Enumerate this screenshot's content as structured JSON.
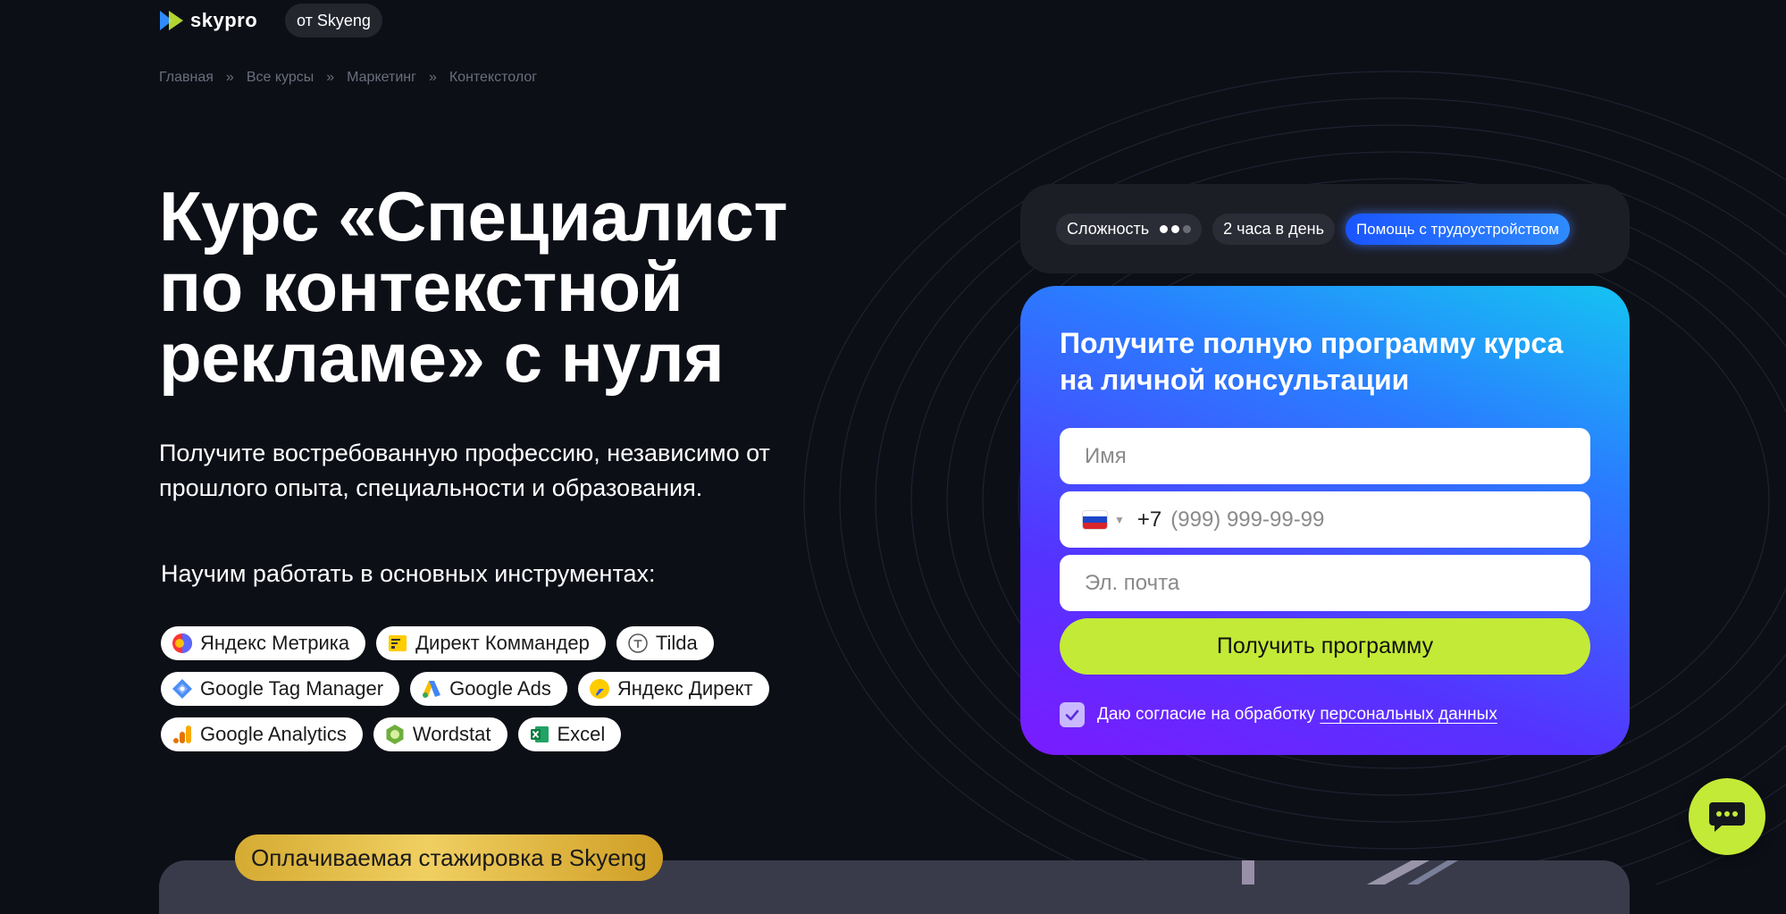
{
  "header": {
    "logo_text": "skypro",
    "from_badge": "от Skyeng"
  },
  "breadcrumb": [
    {
      "label": "Главная"
    },
    {
      "label": "Все курсы"
    },
    {
      "label": "Маркетинг"
    },
    {
      "label": "Контекстолог"
    }
  ],
  "breadcrumb_separator": "»",
  "hero": {
    "title": "Курс «Специалист по контекстной рекламе» с нуля",
    "subtitle": "Получите востребованную профессию, независимо от прошлого опыта, специальности и образования.",
    "tools_heading": "Научим работать в основных инструментах:"
  },
  "tools": [
    [
      {
        "label": "Яндекс Метрика",
        "icon": "yandex-metrika-icon"
      },
      {
        "label": "Директ Коммандер",
        "icon": "direct-commander-icon"
      },
      {
        "label": "Tilda",
        "icon": "tilda-icon"
      }
    ],
    [
      {
        "label": "Google Tag Manager",
        "icon": "google-tag-manager-icon"
      },
      {
        "label": "Google Ads",
        "icon": "google-ads-icon"
      },
      {
        "label": "Яндекс Директ",
        "icon": "yandex-direct-icon"
      }
    ],
    [
      {
        "label": "Google Analytics",
        "icon": "google-analytics-icon"
      },
      {
        "label": "Wordstat",
        "icon": "wordstat-icon"
      },
      {
        "label": "Excel",
        "icon": "excel-icon"
      }
    ]
  ],
  "info": {
    "difficulty_label": "Сложность",
    "difficulty_level": 2,
    "difficulty_max": 3,
    "hours_label": "2 часа в день",
    "job_help_label": "Помощь с трудоустройством"
  },
  "form": {
    "title": "Получите полную программу курса на личной консультации",
    "name_placeholder": "Имя",
    "phone_country": "RU",
    "phone_code": "+7",
    "phone_placeholder": "(999) 999-99-99",
    "email_placeholder": "Эл. почта",
    "submit_label": "Получить программу",
    "consent_text": "Даю согласие на обработку",
    "consent_link": "персональных данных",
    "consent_checked": true
  },
  "promo": {
    "internship_label": "Оплачиваемая стажировка в Skyeng"
  },
  "colors": {
    "background": "#0d0f17",
    "accent_lime": "#c3ea36",
    "accent_blue": "#1a55ff",
    "form_gradient_start": "#15c3f2",
    "form_gradient_end": "#7a1bff",
    "gold": "#f0cf61"
  }
}
